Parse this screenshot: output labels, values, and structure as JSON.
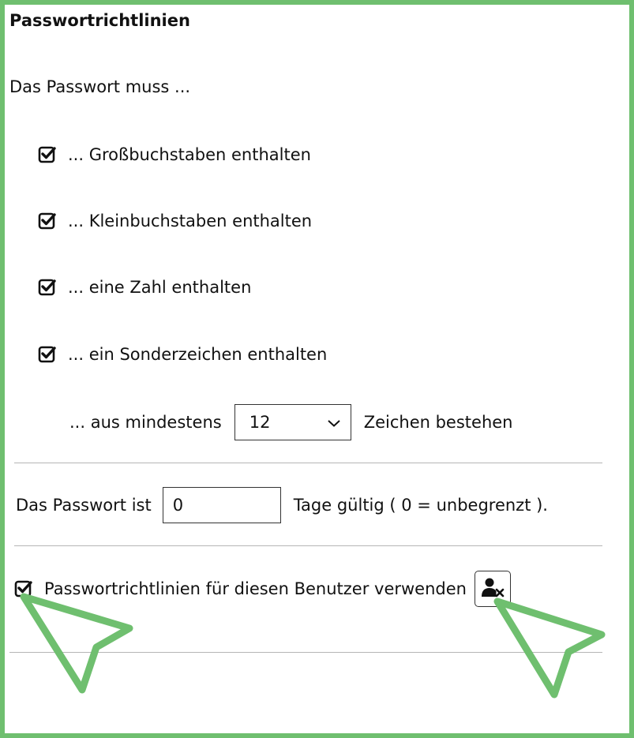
{
  "section": {
    "title": "Passwortrichtlinien"
  },
  "policy": {
    "intro": "Das Passwort muss ...",
    "rules": [
      {
        "label": "... Großbuchstaben enthalten",
        "checked": true
      },
      {
        "label": "... Kleinbuchstaben enthalten",
        "checked": true
      },
      {
        "label": "... eine Zahl enthalten",
        "checked": true
      },
      {
        "label": "... ein Sonderzeichen enthalten",
        "checked": true
      }
    ],
    "min_length": {
      "prefix": "... aus mindestens",
      "value": "12",
      "suffix": "Zeichen bestehen"
    }
  },
  "expiry": {
    "prefix": "Das Passwort ist",
    "value": "0",
    "suffix": "Tage gültig ( 0 = unbegrenzt )."
  },
  "user_policy": {
    "label": "Passwortrichtlinien für diesen Benutzer verwenden",
    "checked": true,
    "button_icon": "user-remove-icon"
  },
  "colors": {
    "frame": "#6fbf6f",
    "annotation_pointer": "#6fbf6f"
  },
  "annotations": [
    "pointer-arrow",
    "pointer-arrow"
  ]
}
